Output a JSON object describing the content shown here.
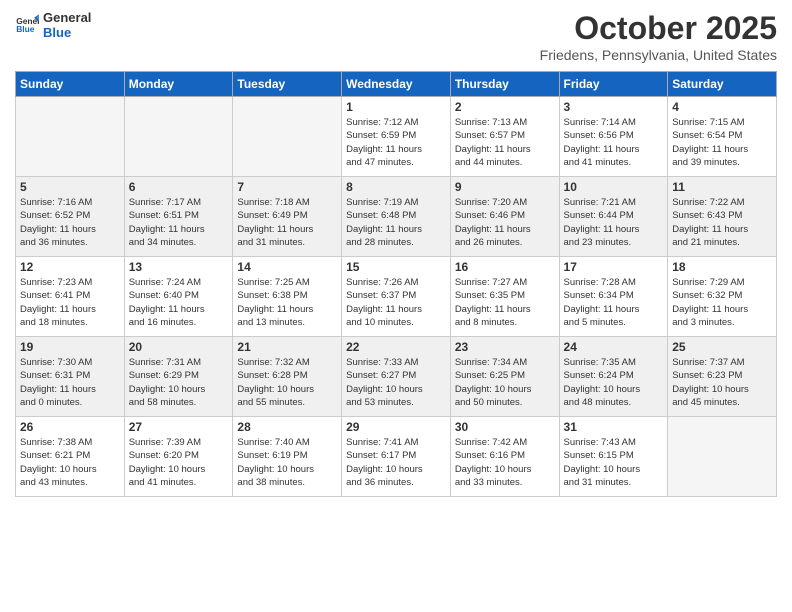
{
  "header": {
    "logo_line1": "General",
    "logo_line2": "Blue",
    "month": "October 2025",
    "location": "Friedens, Pennsylvania, United States"
  },
  "days_of_week": [
    "Sunday",
    "Monday",
    "Tuesday",
    "Wednesday",
    "Thursday",
    "Friday",
    "Saturday"
  ],
  "weeks": [
    [
      {
        "day": "",
        "info": ""
      },
      {
        "day": "",
        "info": ""
      },
      {
        "day": "",
        "info": ""
      },
      {
        "day": "1",
        "info": "Sunrise: 7:12 AM\nSunset: 6:59 PM\nDaylight: 11 hours\nand 47 minutes."
      },
      {
        "day": "2",
        "info": "Sunrise: 7:13 AM\nSunset: 6:57 PM\nDaylight: 11 hours\nand 44 minutes."
      },
      {
        "day": "3",
        "info": "Sunrise: 7:14 AM\nSunset: 6:56 PM\nDaylight: 11 hours\nand 41 minutes."
      },
      {
        "day": "4",
        "info": "Sunrise: 7:15 AM\nSunset: 6:54 PM\nDaylight: 11 hours\nand 39 minutes."
      }
    ],
    [
      {
        "day": "5",
        "info": "Sunrise: 7:16 AM\nSunset: 6:52 PM\nDaylight: 11 hours\nand 36 minutes."
      },
      {
        "day": "6",
        "info": "Sunrise: 7:17 AM\nSunset: 6:51 PM\nDaylight: 11 hours\nand 34 minutes."
      },
      {
        "day": "7",
        "info": "Sunrise: 7:18 AM\nSunset: 6:49 PM\nDaylight: 11 hours\nand 31 minutes."
      },
      {
        "day": "8",
        "info": "Sunrise: 7:19 AM\nSunset: 6:48 PM\nDaylight: 11 hours\nand 28 minutes."
      },
      {
        "day": "9",
        "info": "Sunrise: 7:20 AM\nSunset: 6:46 PM\nDaylight: 11 hours\nand 26 minutes."
      },
      {
        "day": "10",
        "info": "Sunrise: 7:21 AM\nSunset: 6:44 PM\nDaylight: 11 hours\nand 23 minutes."
      },
      {
        "day": "11",
        "info": "Sunrise: 7:22 AM\nSunset: 6:43 PM\nDaylight: 11 hours\nand 21 minutes."
      }
    ],
    [
      {
        "day": "12",
        "info": "Sunrise: 7:23 AM\nSunset: 6:41 PM\nDaylight: 11 hours\nand 18 minutes."
      },
      {
        "day": "13",
        "info": "Sunrise: 7:24 AM\nSunset: 6:40 PM\nDaylight: 11 hours\nand 16 minutes."
      },
      {
        "day": "14",
        "info": "Sunrise: 7:25 AM\nSunset: 6:38 PM\nDaylight: 11 hours\nand 13 minutes."
      },
      {
        "day": "15",
        "info": "Sunrise: 7:26 AM\nSunset: 6:37 PM\nDaylight: 11 hours\nand 10 minutes."
      },
      {
        "day": "16",
        "info": "Sunrise: 7:27 AM\nSunset: 6:35 PM\nDaylight: 11 hours\nand 8 minutes."
      },
      {
        "day": "17",
        "info": "Sunrise: 7:28 AM\nSunset: 6:34 PM\nDaylight: 11 hours\nand 5 minutes."
      },
      {
        "day": "18",
        "info": "Sunrise: 7:29 AM\nSunset: 6:32 PM\nDaylight: 11 hours\nand 3 minutes."
      }
    ],
    [
      {
        "day": "19",
        "info": "Sunrise: 7:30 AM\nSunset: 6:31 PM\nDaylight: 11 hours\nand 0 minutes."
      },
      {
        "day": "20",
        "info": "Sunrise: 7:31 AM\nSunset: 6:29 PM\nDaylight: 10 hours\nand 58 minutes."
      },
      {
        "day": "21",
        "info": "Sunrise: 7:32 AM\nSunset: 6:28 PM\nDaylight: 10 hours\nand 55 minutes."
      },
      {
        "day": "22",
        "info": "Sunrise: 7:33 AM\nSunset: 6:27 PM\nDaylight: 10 hours\nand 53 minutes."
      },
      {
        "day": "23",
        "info": "Sunrise: 7:34 AM\nSunset: 6:25 PM\nDaylight: 10 hours\nand 50 minutes."
      },
      {
        "day": "24",
        "info": "Sunrise: 7:35 AM\nSunset: 6:24 PM\nDaylight: 10 hours\nand 48 minutes."
      },
      {
        "day": "25",
        "info": "Sunrise: 7:37 AM\nSunset: 6:23 PM\nDaylight: 10 hours\nand 45 minutes."
      }
    ],
    [
      {
        "day": "26",
        "info": "Sunrise: 7:38 AM\nSunset: 6:21 PM\nDaylight: 10 hours\nand 43 minutes."
      },
      {
        "day": "27",
        "info": "Sunrise: 7:39 AM\nSunset: 6:20 PM\nDaylight: 10 hours\nand 41 minutes."
      },
      {
        "day": "28",
        "info": "Sunrise: 7:40 AM\nSunset: 6:19 PM\nDaylight: 10 hours\nand 38 minutes."
      },
      {
        "day": "29",
        "info": "Sunrise: 7:41 AM\nSunset: 6:17 PM\nDaylight: 10 hours\nand 36 minutes."
      },
      {
        "day": "30",
        "info": "Sunrise: 7:42 AM\nSunset: 6:16 PM\nDaylight: 10 hours\nand 33 minutes."
      },
      {
        "day": "31",
        "info": "Sunrise: 7:43 AM\nSunset: 6:15 PM\nDaylight: 10 hours\nand 31 minutes."
      },
      {
        "day": "",
        "info": ""
      }
    ]
  ]
}
